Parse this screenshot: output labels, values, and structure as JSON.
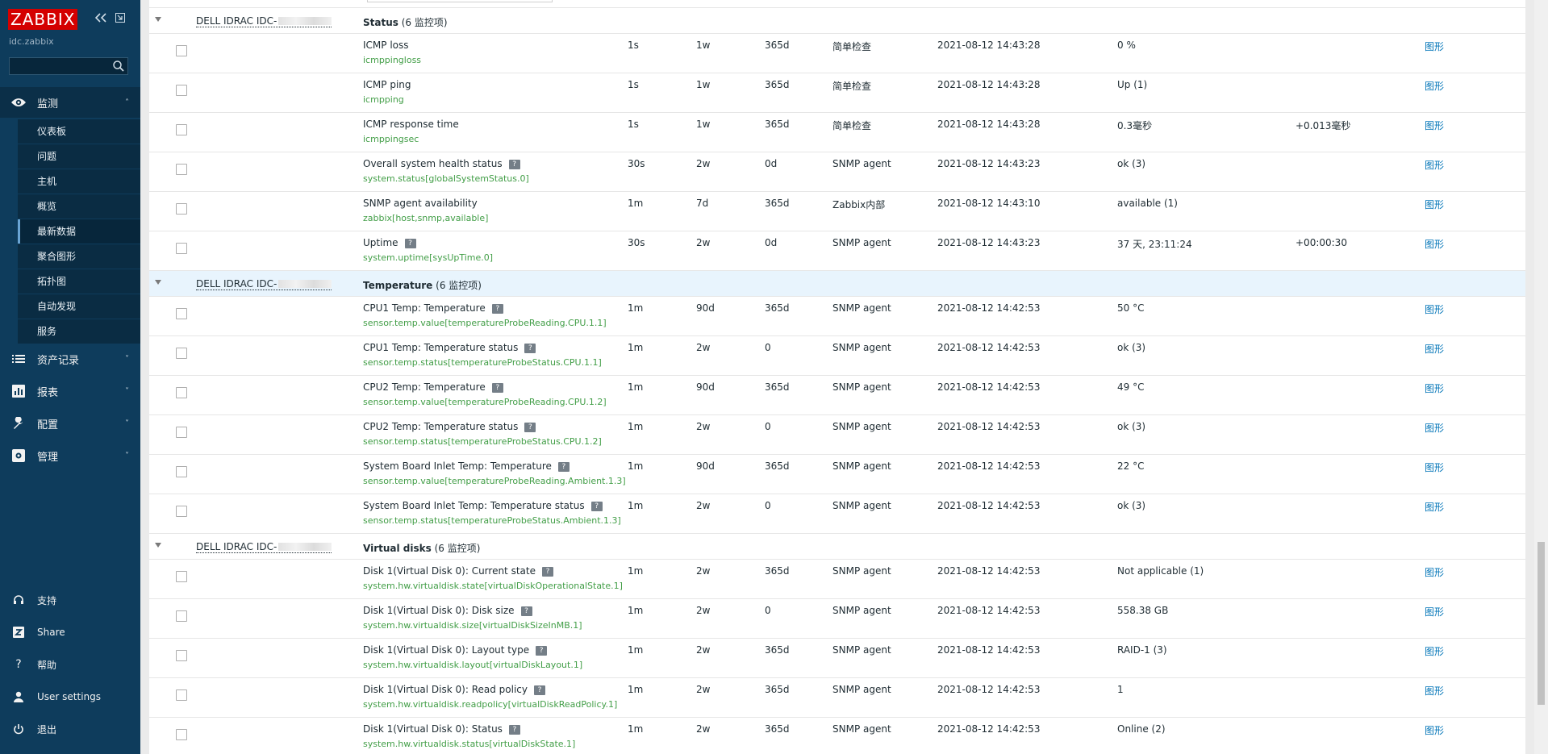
{
  "sidebar": {
    "logo": "ZABBIX",
    "server_name": "idc.zabbix",
    "search_placeholder": "",
    "nav": [
      {
        "label": "监测",
        "icon": "eye-icon",
        "active": true
      },
      {
        "label": "资产记录",
        "icon": "list-icon"
      },
      {
        "label": "报表",
        "icon": "report-chart-icon"
      },
      {
        "label": "配置",
        "icon": "wrench-icon"
      },
      {
        "label": "管理",
        "icon": "admin-gear-icon"
      }
    ],
    "submenu": [
      "仪表板",
      "问题",
      "主机",
      "概览",
      "最新数据",
      "聚合图形",
      "拓扑图",
      "自动发现",
      "服务"
    ],
    "submenu_selected": 4,
    "bottom": [
      {
        "label": "支持",
        "icon": "headset-icon"
      },
      {
        "label": "Share",
        "icon": "share-z-icon"
      },
      {
        "label": "帮助",
        "icon": "question-icon"
      },
      {
        "label": "User settings",
        "icon": "user-icon"
      },
      {
        "label": "退出",
        "icon": "power-icon"
      }
    ]
  },
  "groups": [
    {
      "host": "DELL IDRAC IDC-",
      "app": "Status",
      "count": "(6 监控项)",
      "highlight": false,
      "items": [
        {
          "name": "ICMP loss",
          "key": "icmppingloss",
          "interval": "1s",
          "history": "1w",
          "trends": "365d",
          "type": "简单检查",
          "last_check": "2021-08-12 14:43:28",
          "last_value": "0 %",
          "change": "",
          "help": false
        },
        {
          "name": "ICMP ping",
          "key": "icmpping",
          "interval": "1s",
          "history": "1w",
          "trends": "365d",
          "type": "简单检查",
          "last_check": "2021-08-12 14:43:28",
          "last_value": "Up (1)",
          "change": "",
          "help": false
        },
        {
          "name": "ICMP response time",
          "key": "icmppingsec",
          "interval": "1s",
          "history": "1w",
          "trends": "365d",
          "type": "简单检查",
          "last_check": "2021-08-12 14:43:28",
          "last_value": "0.3毫秒",
          "change": "+0.013毫秒",
          "help": false
        },
        {
          "name": "Overall system health status",
          "key": "system.status[globalSystemStatus.0]",
          "interval": "30s",
          "history": "2w",
          "trends": "0d",
          "type": "SNMP agent",
          "last_check": "2021-08-12 14:43:23",
          "last_value": "ok (3)",
          "change": "",
          "help": true
        },
        {
          "name": "SNMP agent availability",
          "key": "zabbix[host,snmp,available]",
          "interval": "1m",
          "history": "7d",
          "trends": "365d",
          "type": "Zabbix内部",
          "last_check": "2021-08-12 14:43:10",
          "last_value": "available (1)",
          "change": "",
          "help": false
        },
        {
          "name": "Uptime",
          "key": "system.uptime[sysUpTime.0]",
          "interval": "30s",
          "history": "2w",
          "trends": "0d",
          "type": "SNMP agent",
          "last_check": "2021-08-12 14:43:23",
          "last_value": "37 天, 23:11:24",
          "change": "+00:00:30",
          "help": true
        }
      ]
    },
    {
      "host": "DELL IDRAC IDC-",
      "app": "Temperature",
      "count": "(6 监控项)",
      "highlight": true,
      "items": [
        {
          "name": "CPU1 Temp: Temperature",
          "key": "sensor.temp.value[temperatureProbeReading.CPU.1.1]",
          "interval": "1m",
          "history": "90d",
          "trends": "365d",
          "type": "SNMP agent",
          "last_check": "2021-08-12 14:42:53",
          "last_value": "50 °C",
          "change": "",
          "help": true
        },
        {
          "name": "CPU1 Temp: Temperature status",
          "key": "sensor.temp.status[temperatureProbeStatus.CPU.1.1]",
          "interval": "1m",
          "history": "2w",
          "trends": "0",
          "type": "SNMP agent",
          "last_check": "2021-08-12 14:42:53",
          "last_value": "ok (3)",
          "change": "",
          "help": true
        },
        {
          "name": "CPU2 Temp: Temperature",
          "key": "sensor.temp.value[temperatureProbeReading.CPU.1.2]",
          "interval": "1m",
          "history": "90d",
          "trends": "365d",
          "type": "SNMP agent",
          "last_check": "2021-08-12 14:42:53",
          "last_value": "49 °C",
          "change": "",
          "help": true
        },
        {
          "name": "CPU2 Temp: Temperature status",
          "key": "sensor.temp.status[temperatureProbeStatus.CPU.1.2]",
          "interval": "1m",
          "history": "2w",
          "trends": "0",
          "type": "SNMP agent",
          "last_check": "2021-08-12 14:42:53",
          "last_value": "ok (3)",
          "change": "",
          "help": true
        },
        {
          "name": "System Board Inlet Temp: Temperature",
          "key": "sensor.temp.value[temperatureProbeReading.Ambient.1.3]",
          "interval": "1m",
          "history": "90d",
          "trends": "365d",
          "type": "SNMP agent",
          "last_check": "2021-08-12 14:42:53",
          "last_value": "22 °C",
          "change": "",
          "help": true
        },
        {
          "name": "System Board Inlet Temp: Temperature status",
          "key": "sensor.temp.status[temperatureProbeStatus.Ambient.1.3]",
          "interval": "1m",
          "history": "2w",
          "trends": "0",
          "type": "SNMP agent",
          "last_check": "2021-08-12 14:42:53",
          "last_value": "ok (3)",
          "change": "",
          "help": true
        }
      ]
    },
    {
      "host": "DELL IDRAC IDC-",
      "app": "Virtual disks",
      "count": "(6 监控项)",
      "highlight": false,
      "items": [
        {
          "name": "Disk 1(Virtual Disk 0): Current state",
          "key": "system.hw.virtualdisk.state[virtualDiskOperationalState.1]",
          "interval": "1m",
          "history": "2w",
          "trends": "365d",
          "type": "SNMP agent",
          "last_check": "2021-08-12 14:42:53",
          "last_value": "Not applicable (1)",
          "change": "",
          "help": true
        },
        {
          "name": "Disk 1(Virtual Disk 0): Disk size",
          "key": "system.hw.virtualdisk.size[virtualDiskSizeInMB.1]",
          "interval": "1m",
          "history": "2w",
          "trends": "0",
          "type": "SNMP agent",
          "last_check": "2021-08-12 14:42:53",
          "last_value": "558.38 GB",
          "change": "",
          "help": true
        },
        {
          "name": "Disk 1(Virtual Disk 0): Layout type",
          "key": "system.hw.virtualdisk.layout[virtualDiskLayout.1]",
          "interval": "1m",
          "history": "2w",
          "trends": "365d",
          "type": "SNMP agent",
          "last_check": "2021-08-12 14:42:53",
          "last_value": "RAID-1 (3)",
          "change": "",
          "help": true
        },
        {
          "name": "Disk 1(Virtual Disk 0): Read policy",
          "key": "system.hw.virtualdisk.readpolicy[virtualDiskReadPolicy.1]",
          "interval": "1m",
          "history": "2w",
          "trends": "365d",
          "type": "SNMP agent",
          "last_check": "2021-08-12 14:42:53",
          "last_value": "1",
          "change": "",
          "help": true
        },
        {
          "name": "Disk 1(Virtual Disk 0): Status",
          "key": "system.hw.virtualdisk.status[virtualDiskState.1]",
          "interval": "1m",
          "history": "2w",
          "trends": "365d",
          "type": "SNMP agent",
          "last_check": "2021-08-12 14:42:53",
          "last_value": "Online (2)",
          "change": "",
          "help": true
        }
      ]
    }
  ],
  "graph_link_label": "图形",
  "colors": {
    "sidebar_bg": "#0e3c5c",
    "logo_red": "#d40000",
    "key_green": "#429e47",
    "link_blue": "#0275b8",
    "highlight_row": "#e8f4fd"
  }
}
